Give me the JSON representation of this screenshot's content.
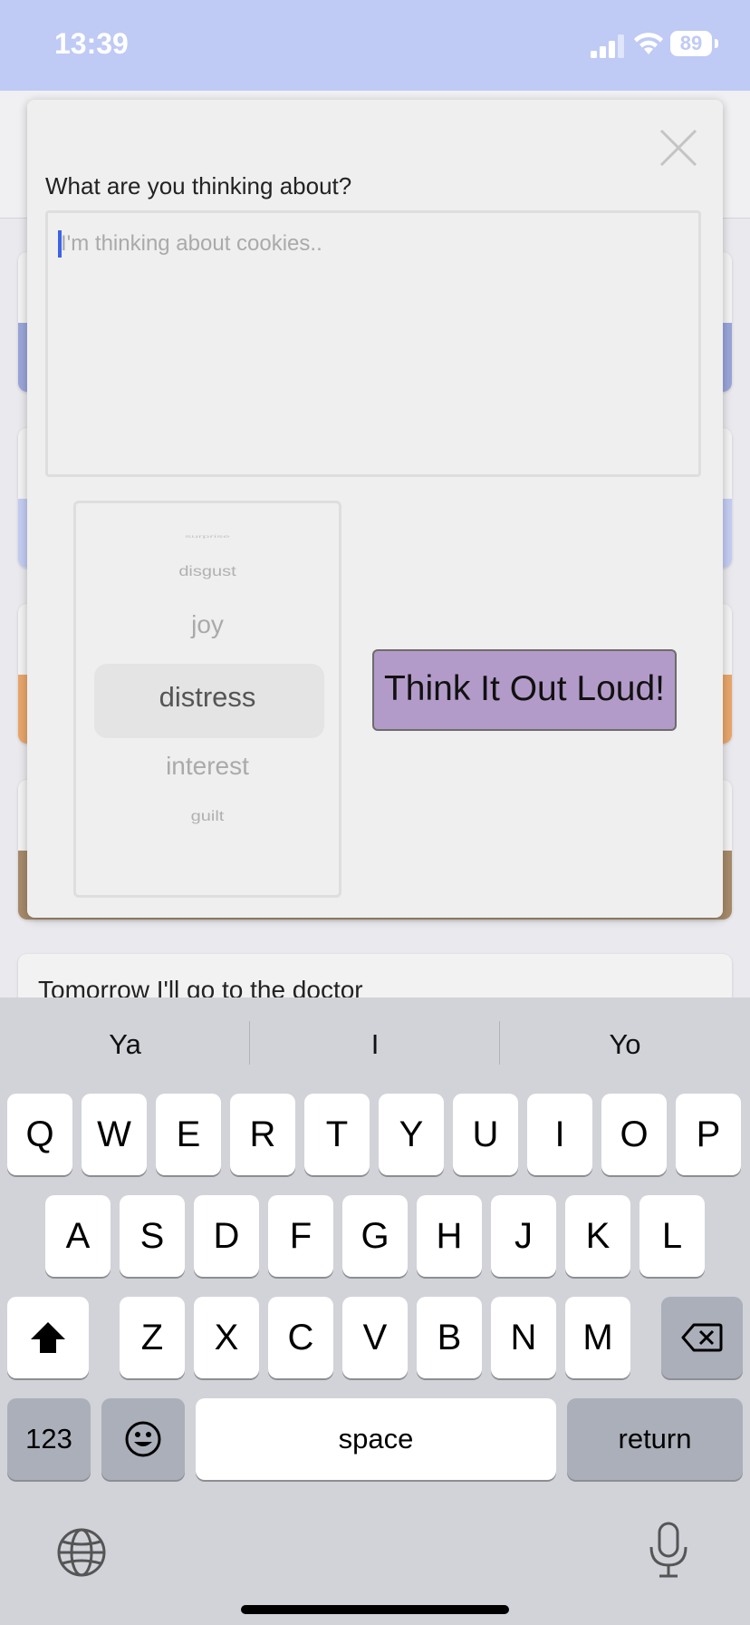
{
  "status_bar": {
    "time": "13:39",
    "battery": "89",
    "icons": [
      "signal-icon",
      "wifi-icon",
      "battery-icon"
    ]
  },
  "background": {
    "last_card_text": "Tomorrow I'll go to the doctor",
    "card_colors": [
      "#99a5d9",
      "#c3cdf2",
      "#e8a56a",
      "#a68a6a"
    ]
  },
  "modal": {
    "prompt_label": "What are you thinking about?",
    "thought_input": {
      "value": "",
      "placeholder": "I'm thinking about cookies.."
    },
    "emotion_picker": {
      "options": [
        "surprise",
        "disgust",
        "joy",
        "distress",
        "interest",
        "guilt"
      ],
      "selected": "distress"
    },
    "submit_label": "Think It Out Loud!",
    "submit_color": "#b39bc9"
  },
  "keyboard": {
    "suggestions": [
      "Ya",
      "I",
      "Yo"
    ],
    "row1": [
      "Q",
      "W",
      "E",
      "R",
      "T",
      "Y",
      "U",
      "I",
      "O",
      "P"
    ],
    "row2": [
      "A",
      "S",
      "D",
      "F",
      "G",
      "H",
      "J",
      "K",
      "L"
    ],
    "row3": [
      "Z",
      "X",
      "C",
      "V",
      "B",
      "N",
      "M"
    ],
    "numbers_label": "123",
    "space_label": "space",
    "return_label": "return"
  }
}
